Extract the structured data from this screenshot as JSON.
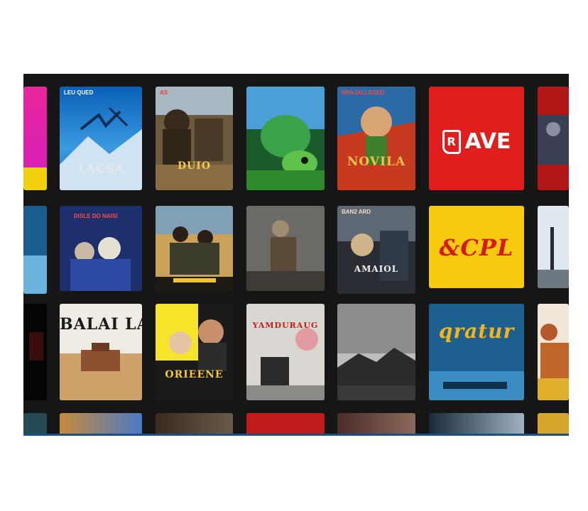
{
  "colors": {
    "background": "#161616",
    "edge": "#1d4f86",
    "red_tile": "#e01e1e",
    "yellow_tile": "#f7c90f"
  },
  "grid": {
    "rows": [
      {
        "tiles": [
          {
            "name": "poster-magenta-yellow-partial",
            "title": "",
            "top": ""
          },
          {
            "name": "poster-lacsa",
            "title": "LACSA",
            "top": "LEU QUED"
          },
          {
            "name": "poster-brown-adventure",
            "title": "DUIO",
            "top": "AS"
          },
          {
            "name": "poster-green-creature",
            "title": "",
            "top": ""
          },
          {
            "name": "poster-novila",
            "title": "NOVILA",
            "top": "NRAJALLAGED"
          },
          {
            "name": "tile-ave-logo",
            "title": "AVE",
            "top": ""
          },
          {
            "name": "poster-red-partial",
            "title": "",
            "top": ""
          }
        ]
      },
      {
        "tiles": [
          {
            "name": "poster-blue-partial",
            "title": "",
            "top": ""
          },
          {
            "name": "poster-blue-group",
            "title": "",
            "top": "DISLE DO NAISI"
          },
          {
            "name": "poster-mountain-trio",
            "title": "",
            "top": ""
          },
          {
            "name": "poster-stone-figure",
            "title": "",
            "top": ""
          },
          {
            "name": "poster-dark-sea",
            "title": "AMAIOL",
            "top": "BAN2 ARD"
          },
          {
            "name": "tile-yellow-logo",
            "title": "&CPL",
            "top": ""
          },
          {
            "name": "poster-sky-partial",
            "title": "",
            "top": ""
          }
        ]
      },
      {
        "tiles": [
          {
            "name": "poster-dark-partial",
            "title": "",
            "top": ""
          },
          {
            "name": "poster-balai",
            "title": "BALAI LAI",
            "top": ""
          },
          {
            "name": "poster-yellow-duo",
            "title": "ORIEENE",
            "top": ""
          },
          {
            "name": "poster-pink-figure",
            "title": "YAMDURAUG",
            "top": ""
          },
          {
            "name": "poster-gray-landscape",
            "title": "",
            "top": ""
          },
          {
            "name": "poster-blue-script",
            "title": "qratur",
            "top": ""
          },
          {
            "name": "poster-orange-partial",
            "title": "",
            "top": ""
          }
        ]
      },
      {
        "tiles": [
          {
            "name": "poster-row4-a",
            "title": "",
            "top": ""
          },
          {
            "name": "poster-row4-b",
            "title": "",
            "top": ""
          },
          {
            "name": "poster-row4-c",
            "title": "",
            "top": ""
          },
          {
            "name": "poster-row4-d",
            "title": "",
            "top": ""
          },
          {
            "name": "poster-row4-e",
            "title": "",
            "top": ""
          },
          {
            "name": "poster-row4-f",
            "title": "",
            "top": ""
          },
          {
            "name": "poster-row4-g",
            "title": "",
            "top": ""
          }
        ]
      }
    ]
  }
}
